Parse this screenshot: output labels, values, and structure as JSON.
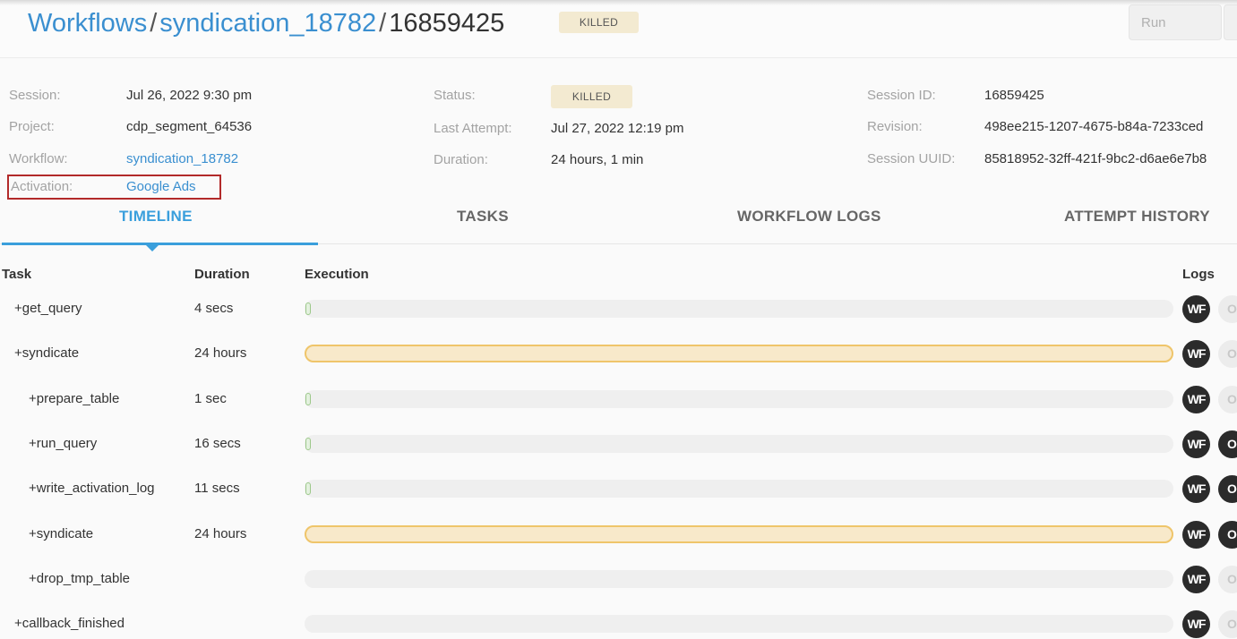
{
  "breadcrumb": {
    "root": "Workflows",
    "workflow": "syndication_18782",
    "session": "16859425",
    "sep": "/",
    "status_badge": "KILLED"
  },
  "toolbar": {
    "run_label": "Run"
  },
  "summary": {
    "session_label": "Session:",
    "session_value": "Jul 26, 2022 9:30 pm",
    "project_label": "Project:",
    "project_value": "cdp_segment_64536",
    "workflow_label": "Workflow:",
    "workflow_value": "syndication_18782",
    "activation_label": "Activation:",
    "activation_value": "Google Ads",
    "status_label": "Status:",
    "status_value": "KILLED",
    "last_attempt_label": "Last Attempt:",
    "last_attempt_value": "Jul 27, 2022 12:19 pm",
    "duration_label": "Duration:",
    "duration_value": "24 hours, 1 min",
    "session_id_label": "Session ID:",
    "session_id_value": "16859425",
    "revision_label": "Revision:",
    "revision_value": "498ee215-1207-4675-b84a-7233ced",
    "uuid_label": "Session UUID:",
    "uuid_value": "85818952-32ff-421f-9bc2-d6ae6e7b8"
  },
  "tabs": [
    {
      "label": "TIMELINE",
      "active": true
    },
    {
      "label": "TASKS",
      "active": false
    },
    {
      "label": "WORKFLOW LOGS",
      "active": false
    },
    {
      "label": "ATTEMPT HISTORY",
      "active": false
    }
  ],
  "table": {
    "headers": {
      "task": "Task",
      "duration": "Duration",
      "execution": "Execution",
      "logs": "Logs"
    },
    "wf_label": "WF",
    "log_label": "O",
    "rows": [
      {
        "task": "+get_query",
        "level": 0,
        "duration": "4 secs",
        "bar": "short",
        "task_log": false
      },
      {
        "task": "+syndicate",
        "level": 0,
        "duration": "24 hours",
        "bar": "long",
        "task_log": false
      },
      {
        "task": "+prepare_table",
        "level": 1,
        "duration": "1 sec",
        "bar": "short",
        "task_log": false
      },
      {
        "task": "+run_query",
        "level": 1,
        "duration": "16 secs",
        "bar": "short",
        "task_log": true
      },
      {
        "task": "+write_activation_log",
        "level": 1,
        "duration": "11 secs",
        "bar": "short",
        "task_log": true
      },
      {
        "task": "+syndicate",
        "level": 1,
        "duration": "24 hours",
        "bar": "long",
        "task_log": true
      },
      {
        "task": "+drop_tmp_table",
        "level": 1,
        "duration": "",
        "bar": "none",
        "task_log": false
      },
      {
        "task": "+callback_finished",
        "level": 0,
        "duration": "",
        "bar": "none",
        "task_log": false
      }
    ]
  },
  "colors": {
    "link": "#3a8fd0",
    "accent": "#3a9fdc",
    "killed_badge_bg": "#f3ead1",
    "running_bar_fill": "#f8e9ca",
    "running_bar_border": "#efc56a",
    "short_bar_border": "#9cc88a",
    "highlight_box": "#b22a2a"
  }
}
